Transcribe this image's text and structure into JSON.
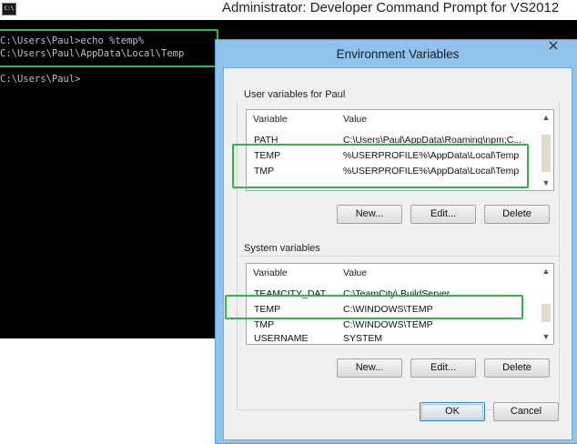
{
  "cmd": {
    "icon_text": "C:\\",
    "title": "Administrator: Developer Command Prompt for VS2012",
    "lines": [
      "C:\\Users\\Paul>echo %temp%",
      "C:\\Users\\Paul\\AppData\\Local\\Temp",
      "C:\\Users\\Paul>"
    ]
  },
  "dialog": {
    "title": "Environment Variables",
    "user": {
      "label": "User variables for Paul",
      "col_variable": "Variable",
      "col_value": "Value",
      "rows": [
        {
          "variable": "PATH",
          "value": "C:\\Users\\Paul\\AppData\\Roaming\\npm;C..."
        },
        {
          "variable": "TEMP",
          "value": "%USERPROFILE%\\AppData\\Local\\Temp"
        },
        {
          "variable": "TMP",
          "value": "%USERPROFILE%\\AppData\\Local\\Temp"
        }
      ],
      "buttons": {
        "new": "New...",
        "edit": "Edit...",
        "delete": "Delete"
      }
    },
    "system": {
      "label": "System variables",
      "col_variable": "Variable",
      "col_value": "Value",
      "rows": [
        {
          "variable": "TEAMCITY_DAT...",
          "value": "C:\\TeamCity\\.BuildServer"
        },
        {
          "variable": "TEMP",
          "value": "C:\\WINDOWS\\TEMP"
        },
        {
          "variable": "TMP",
          "value": "C:\\WINDOWS\\TEMP"
        },
        {
          "variable": "USERNAME",
          "value": "SYSTEM"
        }
      ],
      "buttons": {
        "new": "New...",
        "edit": "Edit...",
        "delete": "Delete"
      }
    },
    "ok": "OK",
    "cancel": "Cancel"
  },
  "colors": {
    "console_bg": "#000000",
    "console_text": "#c0c0c0",
    "highlight": "#2fb84a",
    "dialog_frame": "#8fc3ee"
  }
}
